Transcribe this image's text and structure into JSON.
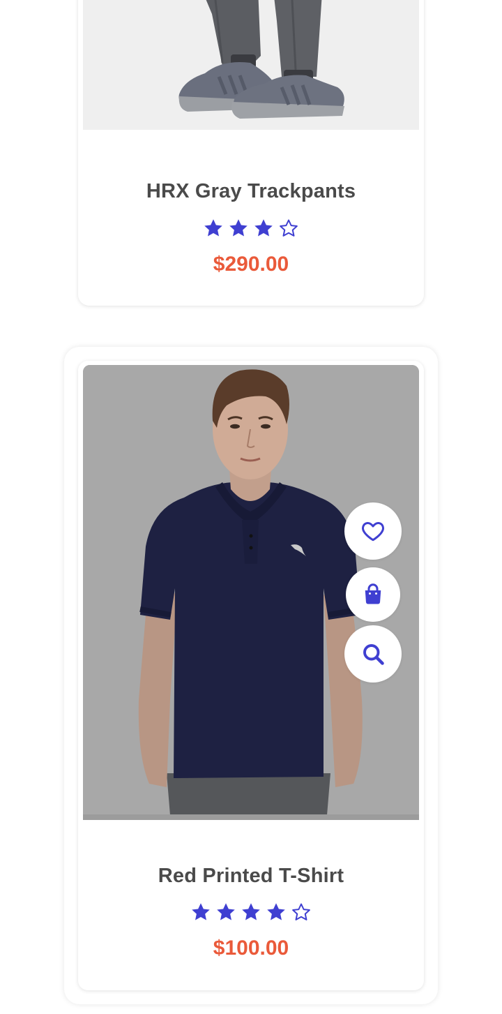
{
  "colors": {
    "accent": "#3f3fd1",
    "price": "#ea5a3a",
    "title": "#4a4a4a",
    "image_overlay": "#a8a8a8"
  },
  "products": [
    {
      "name": "HRX Gray Trackpants",
      "rating": 3,
      "max_rating": 4,
      "price": "$290.00",
      "image_icon": "trackpants-shoes-photo"
    },
    {
      "name": "Red Printed T-Shirt",
      "rating": 4,
      "max_rating": 5,
      "price": "$100.00",
      "image_icon": "tshirt-model-photo",
      "actions": [
        {
          "icon": "heart-icon",
          "label": "Add to wishlist"
        },
        {
          "icon": "shopping-bag-icon",
          "label": "Add to cart"
        },
        {
          "icon": "search-icon",
          "label": "Quick view"
        }
      ]
    }
  ]
}
